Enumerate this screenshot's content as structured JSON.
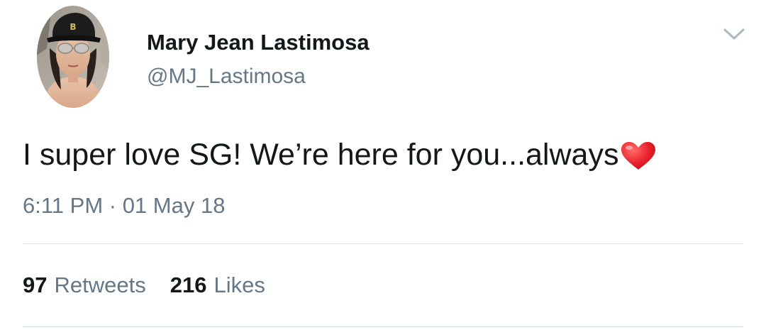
{
  "tweet": {
    "author": {
      "display_name": "Mary Jean Lastimosa",
      "handle": "@MJ_Lastimosa",
      "avatar_icon": "profile-photo"
    },
    "text": "I super love SG! We’re here for you...always",
    "emoji": "heart-emoji",
    "timestamp": "6:11 PM · 01 May 18",
    "stats": {
      "retweets_count": "97",
      "retweets_label": "Retweets",
      "likes_count": "216",
      "likes_label": "Likes"
    },
    "menu_icon": "chevron-down-icon"
  },
  "colors": {
    "text_primary": "#14171a",
    "text_secondary": "#657786",
    "divider": "#d7dde2",
    "chevron": "#aab8c2",
    "heart": "#e0245e"
  }
}
